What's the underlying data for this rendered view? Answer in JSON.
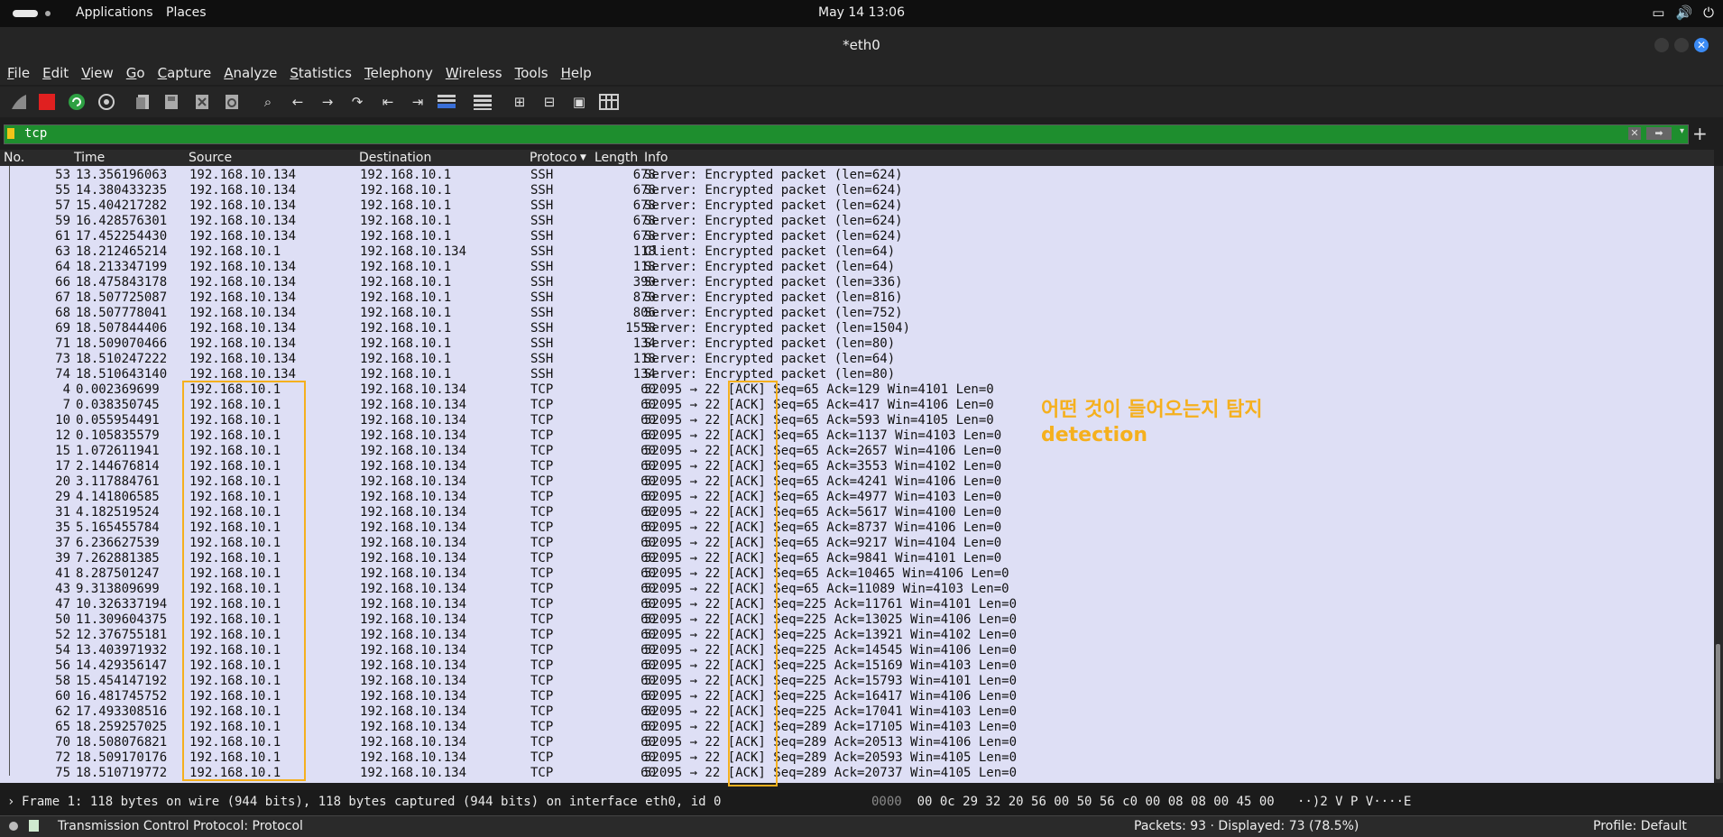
{
  "topbar": {
    "apps": "Applications",
    "places": "Places",
    "clock": "May 14  13:06",
    "tray_icons": [
      "display-icon",
      "volume-icon",
      "power-icon"
    ]
  },
  "window": {
    "title": "*eth0"
  },
  "menu": [
    "File",
    "Edit",
    "View",
    "Go",
    "Capture",
    "Analyze",
    "Statistics",
    "Telephony",
    "Wireless",
    "Tools",
    "Help"
  ],
  "filter": {
    "value": "tcp"
  },
  "columns": {
    "no": "No.",
    "time": "Time",
    "source": "Source",
    "destination": "Destination",
    "protocol": "Protoco",
    "length": "Length",
    "info": "Info"
  },
  "packets": [
    {
      "no": "53",
      "time": "13.356196063",
      "src": "192.168.10.134",
      "dst": "192.168.10.1",
      "proto": "SSH",
      "len": "678",
      "info": "Server: Encrypted packet (len=624)"
    },
    {
      "no": "55",
      "time": "14.380433235",
      "src": "192.168.10.134",
      "dst": "192.168.10.1",
      "proto": "SSH",
      "len": "678",
      "info": "Server: Encrypted packet (len=624)"
    },
    {
      "no": "57",
      "time": "15.404217282",
      "src": "192.168.10.134",
      "dst": "192.168.10.1",
      "proto": "SSH",
      "len": "678",
      "info": "Server: Encrypted packet (len=624)"
    },
    {
      "no": "59",
      "time": "16.428576301",
      "src": "192.168.10.134",
      "dst": "192.168.10.1",
      "proto": "SSH",
      "len": "678",
      "info": "Server: Encrypted packet (len=624)"
    },
    {
      "no": "61",
      "time": "17.452254430",
      "src": "192.168.10.134",
      "dst": "192.168.10.1",
      "proto": "SSH",
      "len": "678",
      "info": "Server: Encrypted packet (len=624)"
    },
    {
      "no": "63",
      "time": "18.212465214",
      "src": "192.168.10.1",
      "dst": "192.168.10.134",
      "proto": "SSH",
      "len": "118",
      "info": "Client: Encrypted packet (len=64)"
    },
    {
      "no": "64",
      "time": "18.213347199",
      "src": "192.168.10.134",
      "dst": "192.168.10.1",
      "proto": "SSH",
      "len": "118",
      "info": "Server: Encrypted packet (len=64)"
    },
    {
      "no": "66",
      "time": "18.475843178",
      "src": "192.168.10.134",
      "dst": "192.168.10.1",
      "proto": "SSH",
      "len": "390",
      "info": "Server: Encrypted packet (len=336)"
    },
    {
      "no": "67",
      "time": "18.507725087",
      "src": "192.168.10.134",
      "dst": "192.168.10.1",
      "proto": "SSH",
      "len": "870",
      "info": "Server: Encrypted packet (len=816)"
    },
    {
      "no": "68",
      "time": "18.507778041",
      "src": "192.168.10.134",
      "dst": "192.168.10.1",
      "proto": "SSH",
      "len": "806",
      "info": "Server: Encrypted packet (len=752)"
    },
    {
      "no": "69",
      "time": "18.507844406",
      "src": "192.168.10.134",
      "dst": "192.168.10.1",
      "proto": "SSH",
      "len": "1558",
      "info": "Server: Encrypted packet (len=1504)"
    },
    {
      "no": "71",
      "time": "18.509070466",
      "src": "192.168.10.134",
      "dst": "192.168.10.1",
      "proto": "SSH",
      "len": "134",
      "info": "Server: Encrypted packet (len=80)"
    },
    {
      "no": "73",
      "time": "18.510247222",
      "src": "192.168.10.134",
      "dst": "192.168.10.1",
      "proto": "SSH",
      "len": "118",
      "info": "Server: Encrypted packet (len=64)"
    },
    {
      "no": "74",
      "time": "18.510643140",
      "src": "192.168.10.134",
      "dst": "192.168.10.1",
      "proto": "SSH",
      "len": "134",
      "info": "Server: Encrypted packet (len=80)"
    },
    {
      "no": "4",
      "time": "0.002369699",
      "src": "192.168.10.1",
      "dst": "192.168.10.134",
      "proto": "TCP",
      "len": "60",
      "info": "52095 → 22 [ACK] Seq=65 Ack=129 Win=4101 Len=0"
    },
    {
      "no": "7",
      "time": "0.038350745",
      "src": "192.168.10.1",
      "dst": "192.168.10.134",
      "proto": "TCP",
      "len": "60",
      "info": "52095 → 22 [ACK] Seq=65 Ack=417 Win=4106 Len=0"
    },
    {
      "no": "10",
      "time": "0.055954491",
      "src": "192.168.10.1",
      "dst": "192.168.10.134",
      "proto": "TCP",
      "len": "60",
      "info": "52095 → 22 [ACK] Seq=65 Ack=593 Win=4105 Len=0"
    },
    {
      "no": "12",
      "time": "0.105835579",
      "src": "192.168.10.1",
      "dst": "192.168.10.134",
      "proto": "TCP",
      "len": "60",
      "info": "52095 → 22 [ACK] Seq=65 Ack=1137 Win=4103 Len=0"
    },
    {
      "no": "15",
      "time": "1.072611941",
      "src": "192.168.10.1",
      "dst": "192.168.10.134",
      "proto": "TCP",
      "len": "60",
      "info": "52095 → 22 [ACK] Seq=65 Ack=2657 Win=4106 Len=0"
    },
    {
      "no": "17",
      "time": "2.144676814",
      "src": "192.168.10.1",
      "dst": "192.168.10.134",
      "proto": "TCP",
      "len": "60",
      "info": "52095 → 22 [ACK] Seq=65 Ack=3553 Win=4102 Len=0"
    },
    {
      "no": "20",
      "time": "3.117884761",
      "src": "192.168.10.1",
      "dst": "192.168.10.134",
      "proto": "TCP",
      "len": "60",
      "info": "52095 → 22 [ACK] Seq=65 Ack=4241 Win=4106 Len=0"
    },
    {
      "no": "29",
      "time": "4.141806585",
      "src": "192.168.10.1",
      "dst": "192.168.10.134",
      "proto": "TCP",
      "len": "60",
      "info": "52095 → 22 [ACK] Seq=65 Ack=4977 Win=4103 Len=0"
    },
    {
      "no": "31",
      "time": "4.182519524",
      "src": "192.168.10.1",
      "dst": "192.168.10.134",
      "proto": "TCP",
      "len": "60",
      "info": "52095 → 22 [ACK] Seq=65 Ack=5617 Win=4100 Len=0"
    },
    {
      "no": "35",
      "time": "5.165455784",
      "src": "192.168.10.1",
      "dst": "192.168.10.134",
      "proto": "TCP",
      "len": "60",
      "info": "52095 → 22 [ACK] Seq=65 Ack=8737 Win=4106 Len=0"
    },
    {
      "no": "37",
      "time": "6.236627539",
      "src": "192.168.10.1",
      "dst": "192.168.10.134",
      "proto": "TCP",
      "len": "60",
      "info": "52095 → 22 [ACK] Seq=65 Ack=9217 Win=4104 Len=0"
    },
    {
      "no": "39",
      "time": "7.262881385",
      "src": "192.168.10.1",
      "dst": "192.168.10.134",
      "proto": "TCP",
      "len": "60",
      "info": "52095 → 22 [ACK] Seq=65 Ack=9841 Win=4101 Len=0"
    },
    {
      "no": "41",
      "time": "8.287501247",
      "src": "192.168.10.1",
      "dst": "192.168.10.134",
      "proto": "TCP",
      "len": "60",
      "info": "52095 → 22 [ACK] Seq=65 Ack=10465 Win=4106 Len=0"
    },
    {
      "no": "43",
      "time": "9.313809699",
      "src": "192.168.10.1",
      "dst": "192.168.10.134",
      "proto": "TCP",
      "len": "60",
      "info": "52095 → 22 [ACK] Seq=65 Ack=11089 Win=4103 Len=0"
    },
    {
      "no": "47",
      "time": "10.326337194",
      "src": "192.168.10.1",
      "dst": "192.168.10.134",
      "proto": "TCP",
      "len": "60",
      "info": "52095 → 22 [ACK] Seq=225 Ack=11761 Win=4101 Len=0"
    },
    {
      "no": "50",
      "time": "11.309604375",
      "src": "192.168.10.1",
      "dst": "192.168.10.134",
      "proto": "TCP",
      "len": "60",
      "info": "52095 → 22 [ACK] Seq=225 Ack=13025 Win=4106 Len=0"
    },
    {
      "no": "52",
      "time": "12.376755181",
      "src": "192.168.10.1",
      "dst": "192.168.10.134",
      "proto": "TCP",
      "len": "60",
      "info": "52095 → 22 [ACK] Seq=225 Ack=13921 Win=4102 Len=0"
    },
    {
      "no": "54",
      "time": "13.403971932",
      "src": "192.168.10.1",
      "dst": "192.168.10.134",
      "proto": "TCP",
      "len": "60",
      "info": "52095 → 22 [ACK] Seq=225 Ack=14545 Win=4106 Len=0"
    },
    {
      "no": "56",
      "time": "14.429356147",
      "src": "192.168.10.1",
      "dst": "192.168.10.134",
      "proto": "TCP",
      "len": "60",
      "info": "52095 → 22 [ACK] Seq=225 Ack=15169 Win=4103 Len=0"
    },
    {
      "no": "58",
      "time": "15.454147192",
      "src": "192.168.10.1",
      "dst": "192.168.10.134",
      "proto": "TCP",
      "len": "60",
      "info": "52095 → 22 [ACK] Seq=225 Ack=15793 Win=4101 Len=0"
    },
    {
      "no": "60",
      "time": "16.481745752",
      "src": "192.168.10.1",
      "dst": "192.168.10.134",
      "proto": "TCP",
      "len": "60",
      "info": "52095 → 22 [ACK] Seq=225 Ack=16417 Win=4106 Len=0"
    },
    {
      "no": "62",
      "time": "17.493308516",
      "src": "192.168.10.1",
      "dst": "192.168.10.134",
      "proto": "TCP",
      "len": "60",
      "info": "52095 → 22 [ACK] Seq=225 Ack=17041 Win=4103 Len=0"
    },
    {
      "no": "65",
      "time": "18.259257025",
      "src": "192.168.10.1",
      "dst": "192.168.10.134",
      "proto": "TCP",
      "len": "60",
      "info": "52095 → 22 [ACK] Seq=289 Ack=17105 Win=4103 Len=0"
    },
    {
      "no": "70",
      "time": "18.508076821",
      "src": "192.168.10.1",
      "dst": "192.168.10.134",
      "proto": "TCP",
      "len": "60",
      "info": "52095 → 22 [ACK] Seq=289 Ack=20513 Win=4106 Len=0"
    },
    {
      "no": "72",
      "time": "18.509170176",
      "src": "192.168.10.1",
      "dst": "192.168.10.134",
      "proto": "TCP",
      "len": "60",
      "info": "52095 → 22 [ACK] Seq=289 Ack=20593 Win=4105 Len=0"
    },
    {
      "no": "75",
      "time": "18.510719772",
      "src": "192.168.10.1",
      "dst": "192.168.10.134",
      "proto": "TCP",
      "len": "60",
      "info": "52095 → 22 [ACK] Seq=289 Ack=20737 Win=4105 Len=0"
    }
  ],
  "annotation": {
    "line1": "어떤 것이 들어오는지 탐지",
    "line2": "detection"
  },
  "details": {
    "frame": "Frame 1: 118 bytes on wire (944 bits), 118 bytes captured (944 bits) on interface eth0, id 0"
  },
  "hexdump": {
    "offset": "0000",
    "bytes": "00 0c 29 32 20 56 00 50  56 c0 00 08 08 00 45 00",
    "ascii": "··)2 V P V····E"
  },
  "status": {
    "protocol": "Transmission Control Protocol: Protocol",
    "packets": "Packets: 93 · Displayed: 73 (78.5%)",
    "profile": "Profile: Default"
  },
  "colors": {
    "accent": "#f5b01e",
    "filter_ok": "#1e8e2e",
    "list_bg": "#dedff5"
  }
}
